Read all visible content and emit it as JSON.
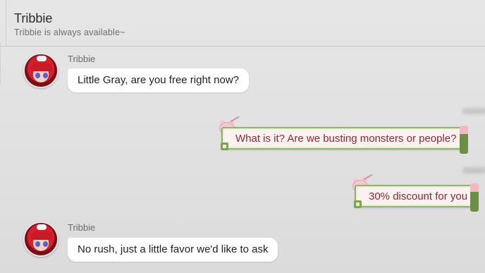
{
  "header": {
    "name": "Tribbie",
    "status": "Tribbie is always available~"
  },
  "messages": [
    {
      "direction": "in",
      "sender": "Tribbie",
      "text": "Little Gray, are you free right now?"
    },
    {
      "direction": "out",
      "text": "What is it? Are we busting monsters or people?"
    },
    {
      "direction": "out",
      "text": "30% discount for you"
    },
    {
      "direction": "in",
      "sender": "Tribbie",
      "text": "No rush, just a little favor we'd like to ask"
    }
  ],
  "colors": {
    "outgoing_text": "#8a2838",
    "outgoing_border": "#8fb46a",
    "incoming_bubble": "#ffffff",
    "avatar_hair": "#d61f2c"
  },
  "icons": {
    "avatar": "tribbie-avatar",
    "sticker": "pink-bunny-sticker"
  }
}
